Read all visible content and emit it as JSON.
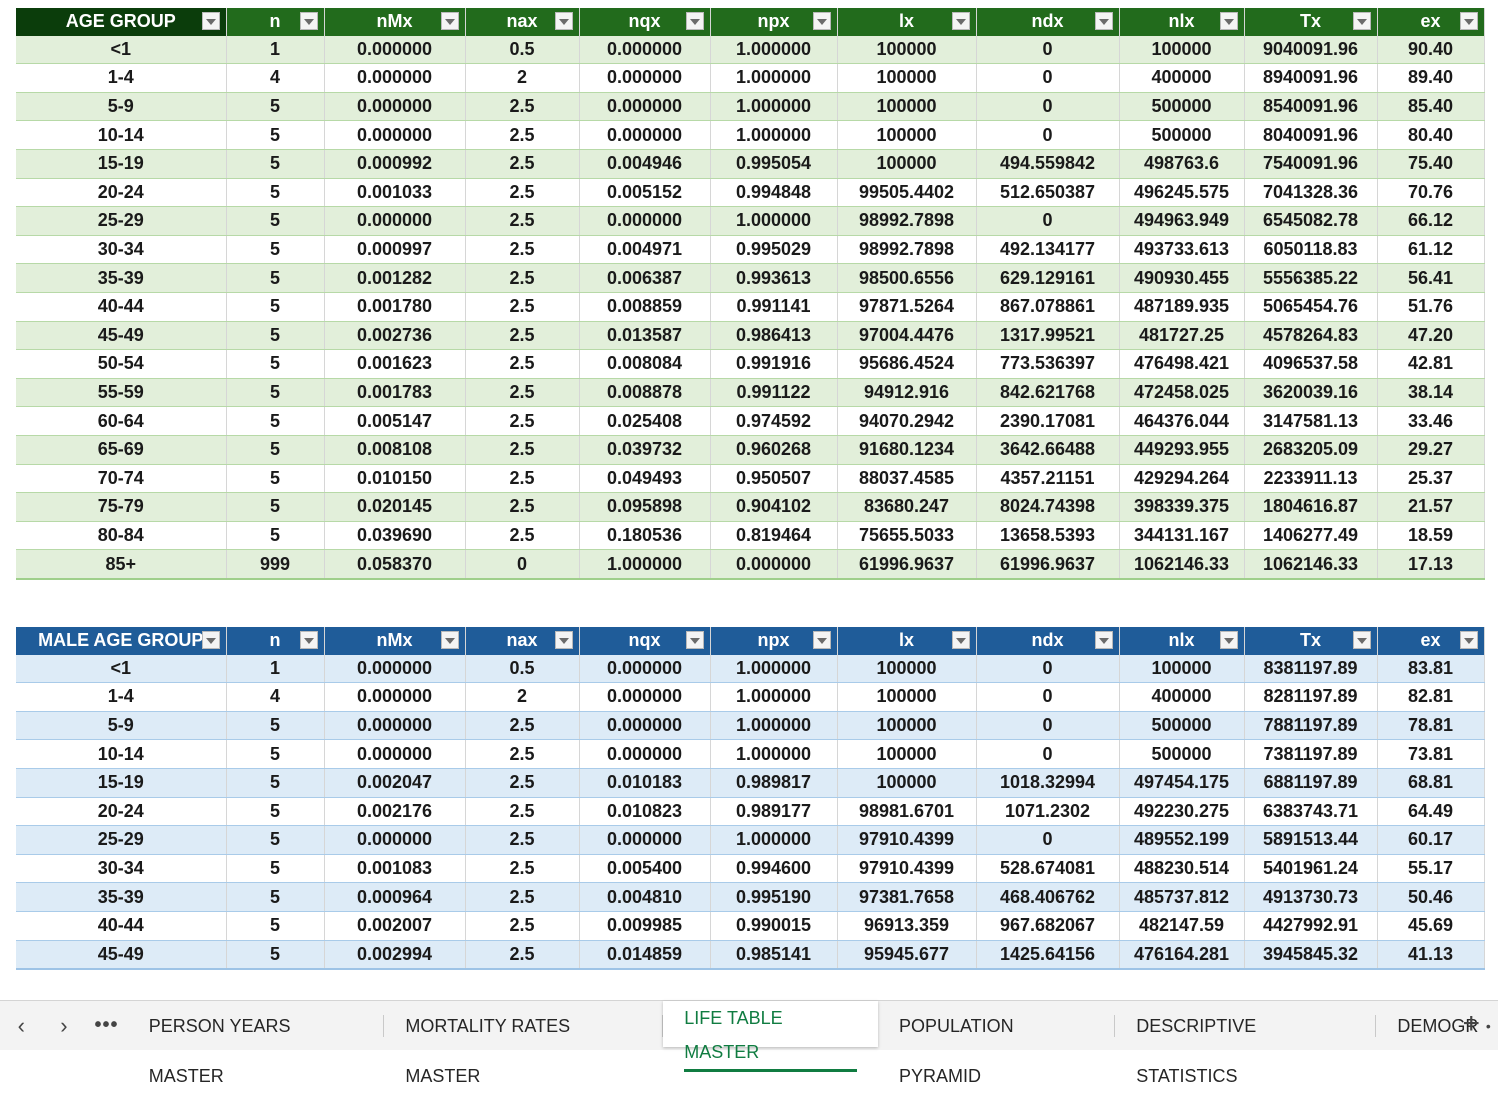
{
  "table1": {
    "headers": [
      "AGE GROUP",
      "n",
      "nMx",
      "nax",
      "nqx",
      "npx",
      "lx",
      "ndx",
      "nlx",
      "Tx",
      "ex"
    ],
    "rows": [
      [
        "<1",
        "1",
        "0.000000",
        "0.5",
        "0.000000",
        "1.000000",
        "100000",
        "0",
        "100000",
        "9040091.96",
        "90.40"
      ],
      [
        "1-4",
        "4",
        "0.000000",
        "2",
        "0.000000",
        "1.000000",
        "100000",
        "0",
        "400000",
        "8940091.96",
        "89.40"
      ],
      [
        "5-9",
        "5",
        "0.000000",
        "2.5",
        "0.000000",
        "1.000000",
        "100000",
        "0",
        "500000",
        "8540091.96",
        "85.40"
      ],
      [
        "10-14",
        "5",
        "0.000000",
        "2.5",
        "0.000000",
        "1.000000",
        "100000",
        "0",
        "500000",
        "8040091.96",
        "80.40"
      ],
      [
        "15-19",
        "5",
        "0.000992",
        "2.5",
        "0.004946",
        "0.995054",
        "100000",
        "494.559842",
        "498763.6",
        "7540091.96",
        "75.40"
      ],
      [
        "20-24",
        "5",
        "0.001033",
        "2.5",
        "0.005152",
        "0.994848",
        "99505.4402",
        "512.650387",
        "496245.575",
        "7041328.36",
        "70.76"
      ],
      [
        "25-29",
        "5",
        "0.000000",
        "2.5",
        "0.000000",
        "1.000000",
        "98992.7898",
        "0",
        "494963.949",
        "6545082.78",
        "66.12"
      ],
      [
        "30-34",
        "5",
        "0.000997",
        "2.5",
        "0.004971",
        "0.995029",
        "98992.7898",
        "492.134177",
        "493733.613",
        "6050118.83",
        "61.12"
      ],
      [
        "35-39",
        "5",
        "0.001282",
        "2.5",
        "0.006387",
        "0.993613",
        "98500.6556",
        "629.129161",
        "490930.455",
        "5556385.22",
        "56.41"
      ],
      [
        "40-44",
        "5",
        "0.001780",
        "2.5",
        "0.008859",
        "0.991141",
        "97871.5264",
        "867.078861",
        "487189.935",
        "5065454.76",
        "51.76"
      ],
      [
        "45-49",
        "5",
        "0.002736",
        "2.5",
        "0.013587",
        "0.986413",
        "97004.4476",
        "1317.99521",
        "481727.25",
        "4578264.83",
        "47.20"
      ],
      [
        "50-54",
        "5",
        "0.001623",
        "2.5",
        "0.008084",
        "0.991916",
        "95686.4524",
        "773.536397",
        "476498.421",
        "4096537.58",
        "42.81"
      ],
      [
        "55-59",
        "5",
        "0.001783",
        "2.5",
        "0.008878",
        "0.991122",
        "94912.916",
        "842.621768",
        "472458.025",
        "3620039.16",
        "38.14"
      ],
      [
        "60-64",
        "5",
        "0.005147",
        "2.5",
        "0.025408",
        "0.974592",
        "94070.2942",
        "2390.17081",
        "464376.044",
        "3147581.13",
        "33.46"
      ],
      [
        "65-69",
        "5",
        "0.008108",
        "2.5",
        "0.039732",
        "0.960268",
        "91680.1234",
        "3642.66488",
        "449293.955",
        "2683205.09",
        "29.27"
      ],
      [
        "70-74",
        "5",
        "0.010150",
        "2.5",
        "0.049493",
        "0.950507",
        "88037.4585",
        "4357.21151",
        "429294.264",
        "2233911.13",
        "25.37"
      ],
      [
        "75-79",
        "5",
        "0.020145",
        "2.5",
        "0.095898",
        "0.904102",
        "83680.247",
        "8024.74398",
        "398339.375",
        "1804616.87",
        "21.57"
      ],
      [
        "80-84",
        "5",
        "0.039690",
        "2.5",
        "0.180536",
        "0.819464",
        "75655.5033",
        "13658.5393",
        "344131.167",
        "1406277.49",
        "18.59"
      ],
      [
        "85+",
        "999",
        "0.058370",
        "0",
        "1.000000",
        "0.000000",
        "61996.9637",
        "61996.9637",
        "1062146.33",
        "1062146.33",
        "17.13"
      ]
    ]
  },
  "table2": {
    "headers": [
      "MALE AGE GROUP",
      "n",
      "nMx",
      "nax",
      "nqx",
      "npx",
      "lx",
      "ndx",
      "nlx",
      "Tx",
      "ex"
    ],
    "rows": [
      [
        "<1",
        "1",
        "0.000000",
        "0.5",
        "0.000000",
        "1.000000",
        "100000",
        "0",
        "100000",
        "8381197.89",
        "83.81"
      ],
      [
        "1-4",
        "4",
        "0.000000",
        "2",
        "0.000000",
        "1.000000",
        "100000",
        "0",
        "400000",
        "8281197.89",
        "82.81"
      ],
      [
        "5-9",
        "5",
        "0.000000",
        "2.5",
        "0.000000",
        "1.000000",
        "100000",
        "0",
        "500000",
        "7881197.89",
        "78.81"
      ],
      [
        "10-14",
        "5",
        "0.000000",
        "2.5",
        "0.000000",
        "1.000000",
        "100000",
        "0",
        "500000",
        "7381197.89",
        "73.81"
      ],
      [
        "15-19",
        "5",
        "0.002047",
        "2.5",
        "0.010183",
        "0.989817",
        "100000",
        "1018.32994",
        "497454.175",
        "6881197.89",
        "68.81"
      ],
      [
        "20-24",
        "5",
        "0.002176",
        "2.5",
        "0.010823",
        "0.989177",
        "98981.6701",
        "1071.2302",
        "492230.275",
        "6383743.71",
        "64.49"
      ],
      [
        "25-29",
        "5",
        "0.000000",
        "2.5",
        "0.000000",
        "1.000000",
        "97910.4399",
        "0",
        "489552.199",
        "5891513.44",
        "60.17"
      ],
      [
        "30-34",
        "5",
        "0.001083",
        "2.5",
        "0.005400",
        "0.994600",
        "97910.4399",
        "528.674081",
        "488230.514",
        "5401961.24",
        "55.17"
      ],
      [
        "35-39",
        "5",
        "0.000964",
        "2.5",
        "0.004810",
        "0.995190",
        "97381.7658",
        "468.406762",
        "485737.812",
        "4913730.73",
        "50.46"
      ],
      [
        "40-44",
        "5",
        "0.002007",
        "2.5",
        "0.009985",
        "0.990015",
        "96913.359",
        "967.682067",
        "482147.59",
        "4427992.91",
        "45.69"
      ],
      [
        "45-49",
        "5",
        "0.002994",
        "2.5",
        "0.014859",
        "0.985141",
        "95945.677",
        "1425.64156",
        "476164.281",
        "3945845.32",
        "41.13"
      ]
    ]
  },
  "sheet_tabs": {
    "prev_icon": "‹",
    "next_icon": "›",
    "more_icon": "•••",
    "tabs": [
      "PERSON YEARS MASTER",
      "MORTALITY RATES MASTER",
      "LIFE TABLE MASTER",
      "POPULATION PYRAMID",
      "DESCRIPTIVE STATISTICS",
      "DEMOGR"
    ],
    "active_index": 2,
    "overflow_dot": "•",
    "add_icon": "+"
  },
  "colors": {
    "green_header": "#226b1c",
    "green_band": "#e2efda",
    "blue_header": "#1f5c99",
    "blue_band": "#ddebf7",
    "active_tab": "#107c41"
  }
}
